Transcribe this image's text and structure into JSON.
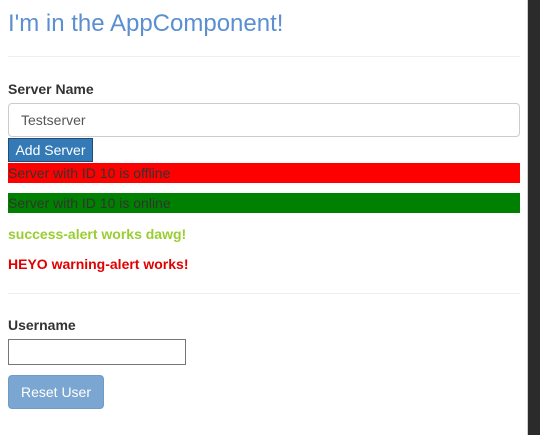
{
  "app": {
    "title": "I'm in the AppComponent!"
  },
  "server_form": {
    "label": "Server Name",
    "input_value": "Testserver",
    "add_button_label": "Add Server"
  },
  "servers": [
    {
      "text": "Server with ID 10 is offline",
      "status": "offline",
      "color": "#ff0000"
    },
    {
      "text": "Server with ID 10 is online",
      "status": "online",
      "color": "#008000"
    }
  ],
  "alerts": {
    "success": "success-alert works dawg!",
    "warning": "HEYO warning-alert works!"
  },
  "user_form": {
    "label": "Username",
    "input_value": "",
    "reset_button_label": "Reset User"
  },
  "colors": {
    "title": "#5b8fd1",
    "primary_button": "#337ab7",
    "success_text": "#9acd32",
    "warning_text": "#e00000"
  }
}
